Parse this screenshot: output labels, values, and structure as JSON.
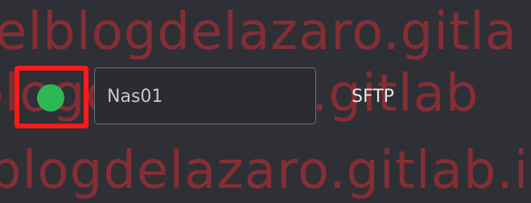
{
  "watermark": {
    "line1": "elblogdelazaro.gitla",
    "line2": "blogdelazaro.gitlab",
    "line3": "blogdelazaro.gitlab.io"
  },
  "row": {
    "name_value": "Nas01",
    "protocol": "SFTP",
    "status_icon": "status-online-icon",
    "status_color": "#2db853"
  },
  "colors": {
    "highlight": "#ff1a1a",
    "watermark": "#8f2e36",
    "background": "#2e3035"
  }
}
